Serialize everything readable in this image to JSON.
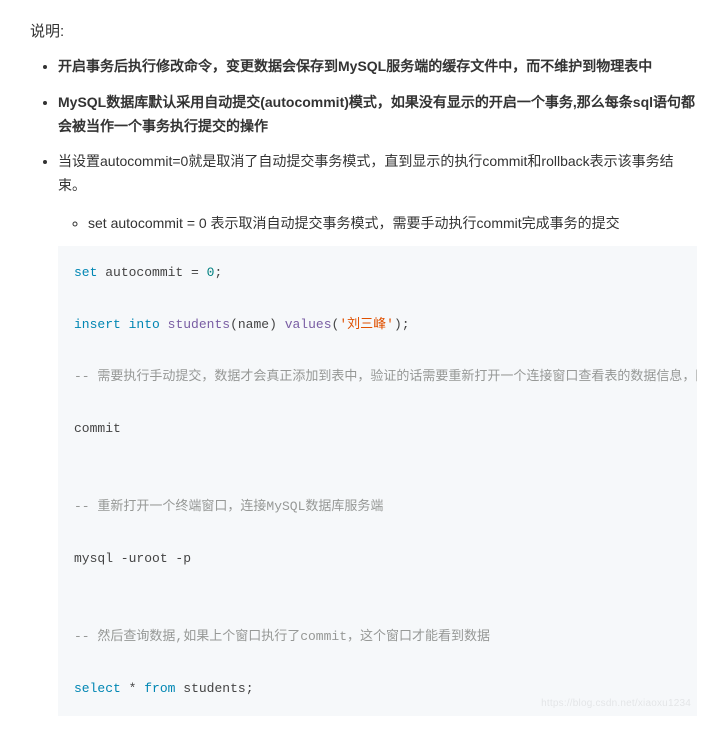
{
  "heading": "说明:",
  "bullets": {
    "b1": "开启事务后执行修改命令，变更数据会保存到MySQL服务端的缓存文件中，而不维护到物理表中",
    "b2": "MySQL数据库默认采用自动提交(autocommit)模式，如果没有显示的开启一个事务,那么每条sql语句都会被当作一个事务执行提交的操作",
    "b3": "当设置autocommit=0就是取消了自动提交事务模式，直到显示的执行commit和rollback表示该事务结束。",
    "sub1": "set autocommit = 0 表示取消自动提交事务模式，需要手动执行commit完成事务的提交"
  },
  "code": {
    "tok": {
      "set": "set",
      "insert": "insert",
      "into": "into",
      "select": "select",
      "from": "from",
      "autocommit": "autocommit",
      "zero": "0",
      "students_fn": "students",
      "values_fn": "values",
      "name_arg": "(name)",
      "val_open": "(",
      "val_close": ");",
      "str_val": "'刘三峰'",
      "commit": "commit",
      "mysql_cmd": "mysql -uroot -p",
      "star": "*",
      "students": "students;",
      "eq": " = ",
      "semi": ";"
    },
    "com": {
      "c1": "-- 需要执行手动提交，数据才会真正添加到表中，验证的话需要重新打开一个连接窗口查看表的数据信息，因为是临时",
      "c2": "-- 重新打开一个终端窗口，连接MySQL数据库服务端",
      "c3": "-- 然后查询数据,如果上个窗口执行了commit，这个窗口才能看到数据"
    }
  },
  "watermark": "https://blog.csdn.net/xiaoxu1234"
}
